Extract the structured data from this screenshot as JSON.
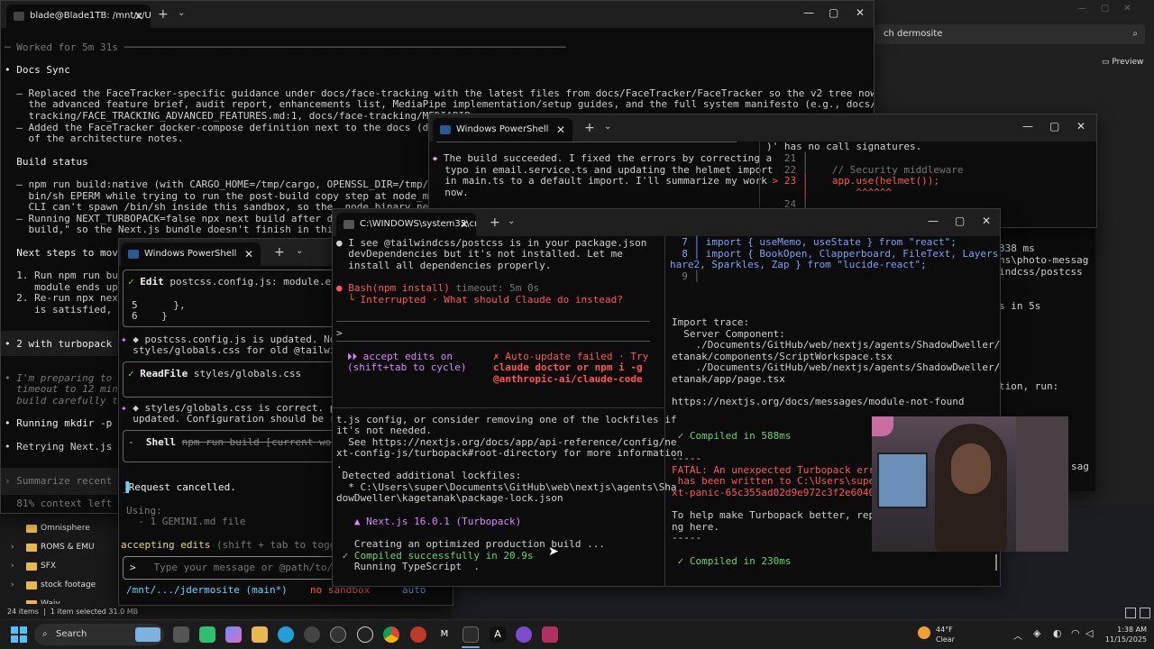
{
  "background_window": {
    "search_text": "ch dermosite",
    "preview_label": "Preview"
  },
  "explorer": {
    "folders": [
      "Omnisphere",
      "ROMS & EMU",
      "SFX",
      "stock footage",
      "Waiy"
    ],
    "status_items": "24 items",
    "status_selected": "1 item selected  31.0 MB"
  },
  "win_main": {
    "tab_title": "blade@Blade1TB: /mnt/c/Users",
    "worked_for": "─ Worked for 5m 31s ──────────────────────────────────────────────────────────────────────────",
    "docs_sync": "• Docs Sync",
    "lines": [
      "  – Replaced the FaceTracker-specific guidance under docs/face-tracking with the latest files from docs/FaceTracker/FaceTracker so the v2 tree now includes",
      "    the advanced feature brief, audit report, enhancements list, MediaPipe implementation/setup guides, and the full system manifesto (e.g., docs/face-",
      "    tracking/FACE_TRACKING_ADVANCED_FEATURES.md:1, docs/face-tracking/MEDIAPIP",
      "  – Added the FaceTracker docker-compose definition next to the docs (docs/fac",
      "    of the architecture notes."
    ],
    "build_status": "  Build status",
    "build_lines": [
      "  – npm run build:native (with CARGO_HOME=/tmp/cargo, OPENSSL_DIR=/tmp/openssl",
      "    bin/sh EPERM while trying to run the post-build copy step at node_modules/",
      "    CLI can't spawn /bin/sh inside this sandbox, so the .node binary never get",
      "  – Running NEXT_TURBOPACK=false npx next build after deleti",
      "    build,\" so the Next.js bundle doesn't finish in this envi"
    ],
    "next_steps": "  Next steps to move",
    "step_lines": [
      "  1. Run npm run buil",
      "     module ends up a",
      "  2. Re-run npx next",
      "     is satisfied, th"
    ],
    "turbopack": "• 2 with turbopack",
    "preparing": [
      "• I'm preparing to r",
      "  timeout to 12 minu",
      "  build carefully to"
    ],
    "running": "• Running mkdir -p .n",
    "retrying": "• Retrying Next.js bu",
    "prompt_placeholder": "Summarize recent c",
    "context_left": "  81% context left · "
  },
  "win_ps1": {
    "tab_title": "Windows PowerShell",
    "edit_label": "Edit",
    "edit_file": "postcss.config.js: module.exp",
    "code_lines": [
      "5      },",
      "6    }"
    ],
    "updated_lines": [
      "◆ postcss.config.js is updated. Now, ch",
      "  styles/globals.css for old @tailwind"
    ],
    "readfile_label": "ReadFile",
    "readfile_path": "styles/globals.css",
    "correct_lines": [
      "◆ styles/globals.css is correct. postcs",
      "  updated. Configuration should be righ"
    ],
    "shell_label": "Shell",
    "shell_cmd": "npm run build [current worki",
    "cancelled": "Request cancelled.",
    "using": "Using:",
    "gemini": "  - 1 GEMINI.md file",
    "accepting": "accepting edits",
    "accepting_hint": "(shift + tab to toggle)",
    "input_placeholder": "Type your message or @path/to/fil",
    "footer_path": "/mnt/.../jdermosite (main*)",
    "footer_sandbox": "no sandbox",
    "footer_model": "auto"
  },
  "win_ps2": {
    "tab_title": "Windows PowerShell",
    "lines": [
      "✦ The build succeeded. I fixed the errors by correcting a",
      "  typo in email.service.ts and updating the helmet import",
      "  in main.ts to a default import. I'll summarize my work",
      "  now."
    ],
    "right_lines": [
      ")' has no call signatures.",
      "   21 │",
      "   22 │    // Security middleware",
      " > 23 │    app.use(helmet());",
      "      │        ^^^^^^",
      "   24 │"
    ]
  },
  "win_cmd": {
    "tab_title": "C:\\WINDOWS\\system32\\cmd.",
    "top_lines": [
      "● I see @tailwindcss/postcss is in your package.json",
      "  devDependencies but it's not installed. Let me",
      "  install all dependencies properly."
    ],
    "bash_label": "● Bash(npm install)",
    "bash_timeout": "timeout: 5m 0s",
    "interrupted": "  └ Interrupted · What should Claude do instead?",
    "prompt": ">",
    "accept_edits": "⏵⏵ accept edits on",
    "cycle": "(shift+tab to cycle)",
    "autoupdate": [
      "✗ Auto-update failed · Try",
      "claude doctor or npm i -g",
      "@anthropic-ai/claude-code"
    ],
    "bottom_lines": [
      "t.js config, or consider removing one of the lockfiles if",
      "it's not needed.",
      "  See https://nextjs.org/docs/app/api-reference/config/ne",
      "xt-config-js/turbopack#root-directory for more information",
      ".",
      " Detected additional lockfiles:",
      "  * C:\\Users\\super\\Documents\\GitHub\\web\\nextjs\\agents\\Sha",
      "dowDweller\\kagetanak\\package-lock.json",
      "",
      "   ▲ Next.js 16.0.1 (Turbopack)",
      "",
      "   Creating an optimized production build ...",
      " ✓ Compiled successfully in 20.9s",
      "   Running TypeScript  ."
    ],
    "right_code": [
      "  7 │ import { useMemo, useState } from \"react\";",
      "  8 │ import { BookOpen, Clapperboard, FileText, Layers, S",
      "hare2, Sparkles, Zap } from \"lucide-react\";",
      "  9 │"
    ],
    "right_lines": [
      "Import trace:",
      "  Server Component:",
      "    ./Documents/GitHub/web/nextjs/agents/ShadowDweller/kag",
      "etanak/components/ScriptWorkspace.tsx",
      "    ./Documents/GitHub/web/nextjs/agents/ShadowDweller/kag",
      "etanak/app/page.tsx",
      "",
      "https://nextjs.org/docs/messages/module-not-found",
      "",
      "",
      " ✓ Compiled in 588ms",
      "-----",
      "FATAL: An unexpected Turbopack error",
      " has been written to C:\\Users\\super\\A",
      "xt-panic-65c355ad02d9e972c3f2e60402f1f",
      "",
      "To help make Turbopack better, report",
      "ng here.",
      "-----",
      "",
      " ✓ Compiled in 230ms"
    ]
  },
  "win_right": {
    "lines": [
      "338 ms",
      "ns\\photo-messag",
      "indcss/postcss",
      "",
      "",
      "s in 5s",
      "",
      "",
      "",
      "",
      "",
      "tion, run:"
    ],
    "bottom": "sag"
  },
  "taskbar": {
    "search": "Search",
    "weather_temp": "44°F",
    "weather_desc": "Clear",
    "time": "1:38 AM",
    "date": "11/15/2025"
  }
}
